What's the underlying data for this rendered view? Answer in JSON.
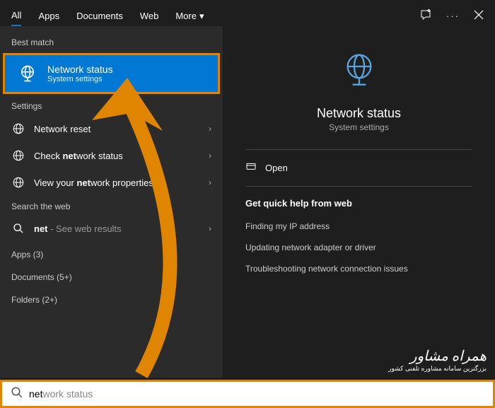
{
  "tabs": {
    "all": "All",
    "apps": "Apps",
    "documents": "Documents",
    "web": "Web",
    "more": "More"
  },
  "sections": {
    "best": "Best match",
    "settings": "Settings",
    "searchweb": "Search the web",
    "apps": "Apps (3)",
    "docs": "Documents (5+)",
    "folders": "Folders (2+)"
  },
  "best": {
    "title": "Network status",
    "sub": "System settings"
  },
  "settings_items": [
    {
      "label": "Network reset"
    },
    {
      "label_pre": "Check ",
      "label_bold": "net",
      "label_post": "work status"
    },
    {
      "label_pre": "View your ",
      "label_bold": "net",
      "label_post": "work properties"
    }
  ],
  "web_item": {
    "bold": "net",
    "rest": " - See web results"
  },
  "detail": {
    "title": "Network status",
    "sub": "System settings",
    "open": "Open",
    "help_title": "Get quick help from web",
    "links": [
      "Finding my IP address",
      "Updating network adapter or driver",
      "Troubleshooting network connection issues"
    ]
  },
  "search": {
    "typed": "net",
    "completion": "work status"
  },
  "watermark": {
    "title": "همراه مشاور",
    "sub": "بزرگترین سامانه مشاوره تلفنی کشور"
  }
}
